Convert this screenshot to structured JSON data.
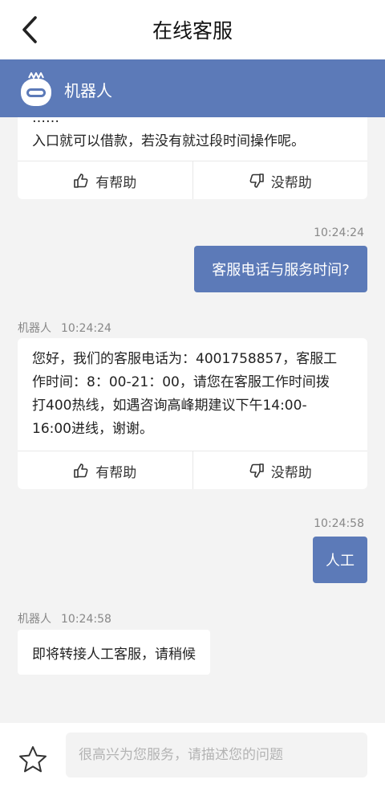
{
  "header": {
    "title": "在线客服",
    "back_icon": "chevron-left-icon"
  },
  "bot_bar": {
    "name": "机器人",
    "avatar_icon": "robot-icon"
  },
  "messages": [
    {
      "from": "bot",
      "text": "…入口就可以借款，若没有就过段时间操作呢。",
      "visible_line": "入口就可以借款，若没有就过段时间操作呢。",
      "helpful": "有帮助",
      "not_helpful": "没帮助"
    },
    {
      "from": "user",
      "time": "10:24:24",
      "text": "客服电话与服务时间?"
    },
    {
      "from": "bot",
      "sender": "机器人",
      "time": "10:24:24",
      "text": "您好，我们的客服电话为：4001758857，客服工作时间：8：00-21：00，请您在客服工作时间拨打400热线，如遇咨询高峰期建议下午14:00-16:00进线，谢谢。",
      "lines": [
        "您好，我们的客服电话为：4001758857，客服工",
        "作时间：8：00-21：00，请您在客服工作时间拨",
        "打400热线，如遇咨询高峰期建议下午14:00-",
        "16:00进线，谢谢。"
      ],
      "helpful": "有帮助",
      "not_helpful": "没帮助"
    },
    {
      "from": "user",
      "time": "10:24:58",
      "text": "人工"
    },
    {
      "from": "bot",
      "sender": "机器人",
      "time": "10:24:58",
      "text": "即将转接人工客服，请稍候"
    }
  ],
  "input": {
    "placeholder": "很高兴为您服务，请描述您的问题",
    "value": "",
    "star_icon": "star-icon"
  },
  "colors": {
    "accent": "#5c7ab8",
    "background": "#f3f3f3",
    "card": "#ffffff"
  }
}
